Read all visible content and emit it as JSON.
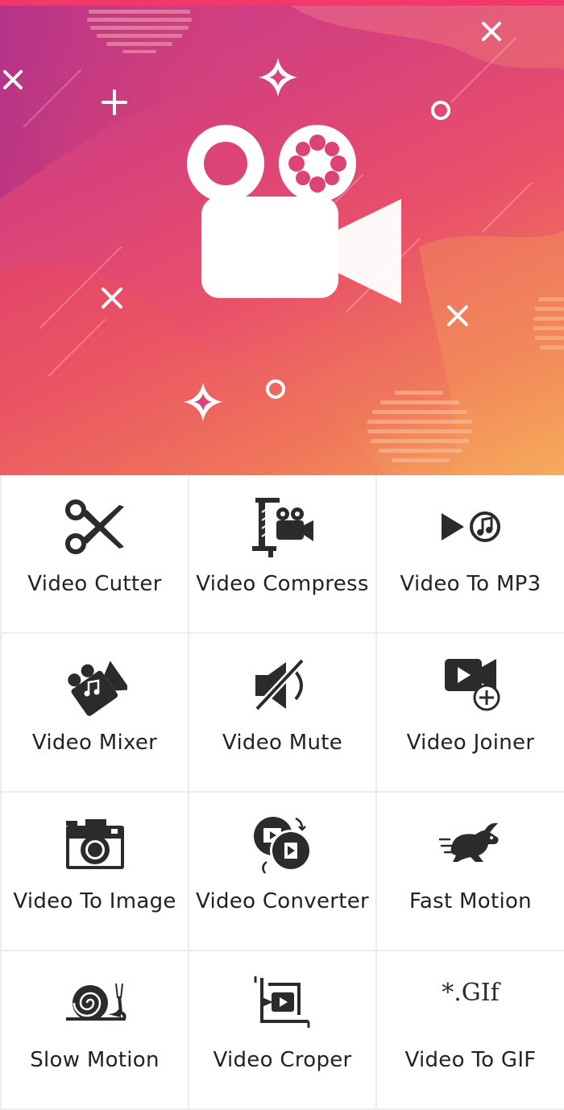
{
  "colors": {
    "accent": "#f0386b",
    "icon": "#2b2b2b",
    "tile_bg": "#ffffff",
    "divider": "#ececec"
  },
  "hero": {
    "icon": "video-camera-icon"
  },
  "tools": [
    {
      "label": "Video Cutter",
      "icon": "scissors-icon"
    },
    {
      "label": "Video Compress",
      "icon": "clamp-camera-icon"
    },
    {
      "label": "Video To MP3",
      "icon": "play-music-note-icon"
    },
    {
      "label": "Video Mixer",
      "icon": "camera-music-icon"
    },
    {
      "label": "Video Mute",
      "icon": "speaker-mute-icon"
    },
    {
      "label": "Video Joiner",
      "icon": "video-add-icon"
    },
    {
      "label": "Video To Image",
      "icon": "photo-camera-icon"
    },
    {
      "label": "Video Converter",
      "icon": "convert-film-icon"
    },
    {
      "label": "Fast Motion",
      "icon": "rabbit-icon"
    },
    {
      "label": "Slow Motion",
      "icon": "snail-icon"
    },
    {
      "label": "Video Croper",
      "icon": "crop-video-icon"
    },
    {
      "label": "Video To GIF",
      "icon": "gif-icon",
      "icon_text": "*.GIf"
    }
  ]
}
